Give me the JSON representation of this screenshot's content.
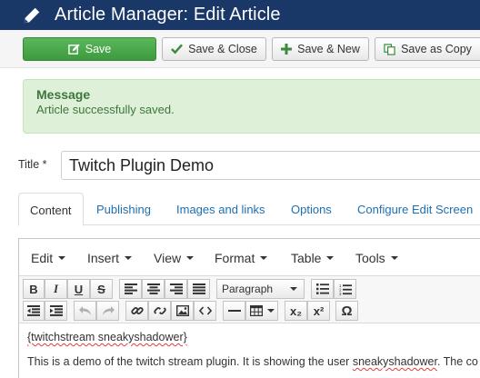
{
  "header": {
    "title": "Article Manager: Edit Article",
    "icon": "pencil-icon"
  },
  "toolbar": {
    "save": "Save",
    "save_close": "Save & Close",
    "save_new": "Save & New",
    "save_copy": "Save as Copy",
    "save_color": "#5bb75b"
  },
  "message": {
    "heading": "Message",
    "text": "Article successfully saved."
  },
  "form": {
    "title_label": "Title *",
    "title_value": "Twitch Plugin Demo"
  },
  "tabs": [
    {
      "label": "Content",
      "active": true
    },
    {
      "label": "Publishing"
    },
    {
      "label": "Images and links"
    },
    {
      "label": "Options"
    },
    {
      "label": "Configure Edit Screen"
    }
  ],
  "editor": {
    "menus": [
      "Edit",
      "Insert",
      "View",
      "Format",
      "Table",
      "Tools"
    ],
    "format_select": "Paragraph",
    "toolbar_buttons": {
      "bold": "B",
      "italic": "I",
      "underline": "U",
      "strike": "S",
      "subscript": "x₂",
      "superscript": "x²",
      "omega": "Ω"
    },
    "content": {
      "line1": "{twitchstream sneakyshadower}",
      "line2_a": "This is a demo of the twitch stream plugin. It is showing the user ",
      "line2_b": "sneakyshadower",
      "line2_c": ". The co"
    }
  }
}
